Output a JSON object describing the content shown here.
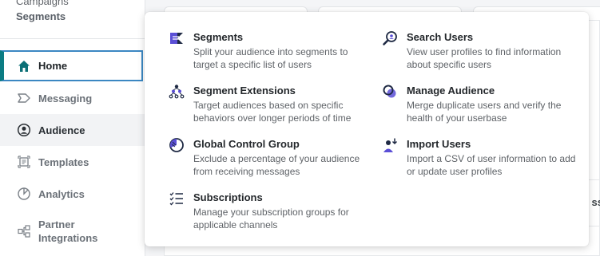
{
  "sidebar": {
    "partial_top_label": "Campaigns",
    "segments_label": "Segments",
    "items": [
      {
        "label": "Home",
        "icon": "home-icon"
      },
      {
        "label": "Messaging",
        "icon": "messaging-icon"
      },
      {
        "label": "Audience",
        "icon": "audience-icon"
      },
      {
        "label": "Templates",
        "icon": "templates-icon"
      },
      {
        "label": "Analytics",
        "icon": "analytics-icon"
      },
      {
        "label": "Partner Integrations",
        "icon": "integrations-icon"
      }
    ]
  },
  "background": {
    "clipped_text": "ss"
  },
  "menu": {
    "items": [
      {
        "title": "Segments",
        "description": "Split your audience into segments to target a specific list of users",
        "icon": "segments-icon"
      },
      {
        "title": "Search Users",
        "description": "View user profiles to find information about specific users",
        "icon": "search-users-icon"
      },
      {
        "title": "Segment Extensions",
        "description": "Target audiences based on specific behaviors over longer periods of time",
        "icon": "segment-extensions-icon"
      },
      {
        "title": "Manage Audience",
        "description": "Merge duplicate users and verify the health of your userbase",
        "icon": "manage-audience-icon"
      },
      {
        "title": "Global Control Group",
        "description": "Exclude a percentage of your audience from receiving messages",
        "icon": "global-control-group-icon"
      },
      {
        "title": "Import Users",
        "description": "Import a CSV of user information to add or update user profiles",
        "icon": "import-users-icon"
      },
      {
        "title": "Subscriptions",
        "description": "Manage your subscription groups for applicable channels",
        "icon": "subscriptions-icon"
      }
    ]
  },
  "colors": {
    "active_accent": "#0b7c83",
    "active_border": "#3b87c2",
    "icon_purple": "#5b4fd6",
    "icon_dark": "#1f2a44"
  }
}
